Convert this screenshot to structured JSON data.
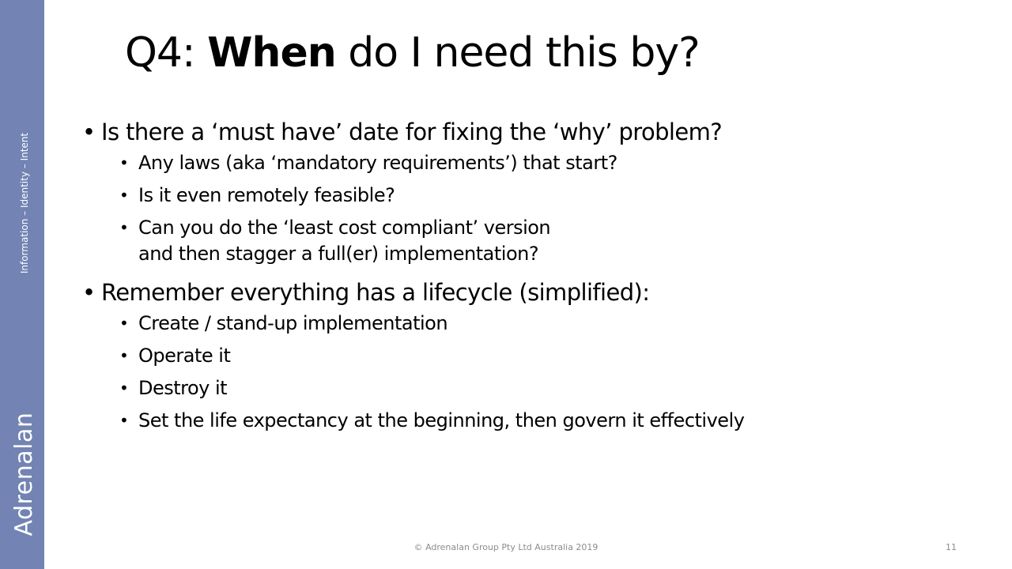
{
  "sidebar": {
    "brand": "Adrenalan",
    "tagline": "Information – Identity – Intent"
  },
  "slide": {
    "title_prefix": "Q4: ",
    "title_bold": "When",
    "title_suffix": " do I need this by?",
    "bullets": [
      {
        "text": "Is there a ‘must have’ date for fixing the ‘why’ problem?",
        "sub": [
          "Any laws (aka ‘mandatory requirements’) that start?",
          "Is it even remotely feasible?",
          "Can you do the ‘least cost compliant’ version",
          "and then stagger a full(er) implementation?"
        ]
      },
      {
        "text": "Remember everything has a lifecycle (simplified):",
        "sub": [
          "Create / stand-up implementation",
          "Operate it",
          "Destroy it",
          "Set the life expectancy at the beginning, then govern it effectively"
        ]
      }
    ]
  },
  "footer": {
    "copyright": "© Adrenalan Group Pty Ltd Australia 2019",
    "page_number": "11"
  },
  "colors": {
    "sidebar": "#7283b4",
    "footer_text": "#8c8c8c"
  }
}
